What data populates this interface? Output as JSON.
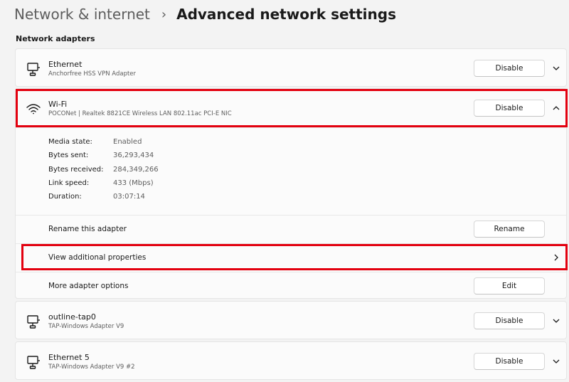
{
  "breadcrumb": {
    "parent": "Network & internet",
    "separator": "›",
    "current": "Advanced network settings"
  },
  "section_label": "Network adapters",
  "adapters": [
    {
      "icon": "ethernet-icon",
      "name": "Ethernet",
      "description": "Anchorfree HSS VPN Adapter",
      "button_label": "Disable",
      "expanded": false
    },
    {
      "icon": "wifi-icon",
      "name": "Wi-Fi",
      "description": "POCONet | Realtek 8821CE Wireless LAN 802.11ac PCI-E NIC",
      "button_label": "Disable",
      "expanded": true,
      "details": [
        {
          "label": "Media state:",
          "value": "Enabled"
        },
        {
          "label": "Bytes sent:",
          "value": "36,293,434"
        },
        {
          "label": "Bytes received:",
          "value": "284,349,266"
        },
        {
          "label": "Link speed:",
          "value": "433 (Mbps)"
        },
        {
          "label": "Duration:",
          "value": "03:07:14"
        }
      ],
      "options": {
        "rename_label": "Rename this adapter",
        "rename_button": "Rename",
        "view_properties_label": "View additional properties",
        "more_options_label": "More adapter options",
        "edit_button": "Edit"
      }
    },
    {
      "icon": "ethernet-icon",
      "name": "outline-tap0",
      "description": "TAP-Windows Adapter V9",
      "button_label": "Disable",
      "expanded": false
    },
    {
      "icon": "ethernet-icon",
      "name": "Ethernet 5",
      "description": "TAP-Windows Adapter V9 #2",
      "button_label": "Disable",
      "expanded": false
    }
  ],
  "colors": {
    "background": "#f3f3f3",
    "card": "#fbfbfb",
    "highlight": "#e3000f",
    "secondary_text": "#5d5d5d"
  }
}
